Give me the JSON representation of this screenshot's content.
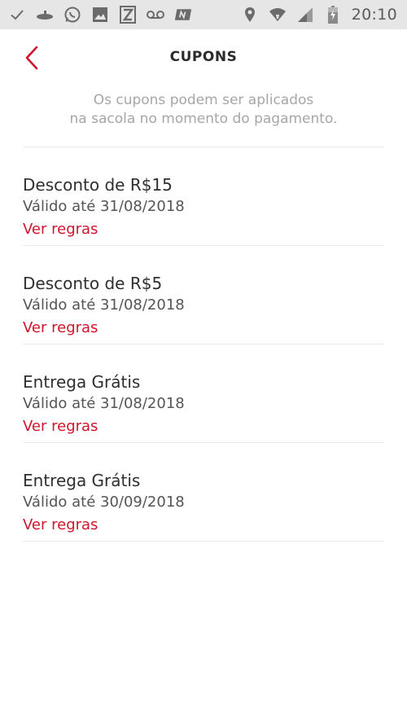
{
  "status_bar": {
    "time": "20:10",
    "left_icons": [
      "check-icon",
      "submarine-icon",
      "whatsapp-icon",
      "image-icon",
      "z-app-icon",
      "voicemail-icon",
      "n-app-icon"
    ],
    "right_icons": [
      "location-icon",
      "wifi-icon",
      "signal-icon",
      "battery-charging-icon"
    ]
  },
  "header": {
    "title": "CUPONS",
    "back_icon": "chevron-left-icon"
  },
  "subtitle": {
    "line1": "Os cupons podem ser aplicados",
    "line2": "na sacola no momento do pagamento."
  },
  "colors": {
    "accent": "#d0142c",
    "status_bar_bg": "#e6e6e6",
    "subtitle": "#a6a6a6",
    "divider": "#e9e9e9"
  },
  "coupons": [
    {
      "title": "Desconto de R$15",
      "validity": "Válido até 31/08/2018",
      "rules_link": "Ver regras"
    },
    {
      "title": "Desconto de R$5",
      "validity": "Válido até 31/08/2018",
      "rules_link": "Ver regras"
    },
    {
      "title": "Entrega Grátis",
      "validity": "Válido até 31/08/2018",
      "rules_link": "Ver regras"
    },
    {
      "title": "Entrega Grátis",
      "validity": "Válido até 30/09/2018",
      "rules_link": "Ver regras"
    }
  ]
}
